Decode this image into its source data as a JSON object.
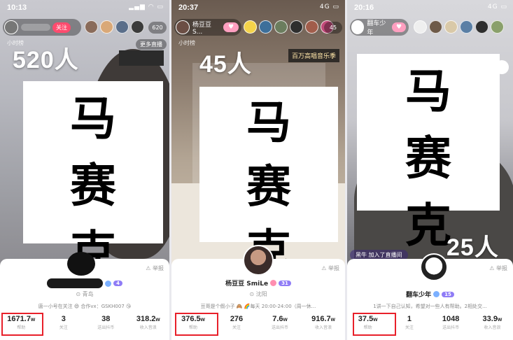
{
  "panels": [
    {
      "status": {
        "time": "10:13",
        "signal": ""
      },
      "anchor": {
        "follow_label": "关注"
      },
      "viewer_count": "620",
      "hour_tag": "小时榜",
      "more_live": "更多直播",
      "overlay_number": "520人",
      "mosaic_chars": [
        "马",
        "赛",
        "克"
      ],
      "shop_sign": "",
      "card": {
        "report": "举报",
        "location": "青岛",
        "level": "4",
        "bio": "唐一小号在关注 😄 合作vx：GSKH007 😘",
        "stats": [
          {
            "value": "1671.7",
            "unit": "w",
            "label": "帮助"
          },
          {
            "value": "3",
            "unit": "",
            "label": "关注"
          },
          {
            "value": "38",
            "unit": "",
            "label": "送出抖币"
          },
          {
            "value": "318.2",
            "unit": "w",
            "label": "收入音浪"
          }
        ]
      }
    },
    {
      "status": {
        "time": "20:37",
        "signal": "4G"
      },
      "anchor": {
        "name": "杨豆豆S..."
      },
      "viewer_count": "45",
      "hour_tag": "小时榜",
      "overlay_number": "45人",
      "song_banner": "百万高唱音乐季",
      "mosaic_chars": [
        "马",
        "赛",
        "克"
      ],
      "card": {
        "report": "举报",
        "name": "杨豆豆 SmiLe",
        "level": "31",
        "location": "沈阳",
        "bio": "豆哥是个假小子 🙈 🌈每天 20:00-24:00（周一休...",
        "stats": [
          {
            "value": "376.5",
            "unit": "w",
            "label": "帮助"
          },
          {
            "value": "276",
            "unit": "",
            "label": "关注"
          },
          {
            "value": "7.6",
            "unit": "w",
            "label": "送出抖币"
          },
          {
            "value": "916.7",
            "unit": "w",
            "label": "收入音浪"
          }
        ]
      }
    },
    {
      "status": {
        "time": "20:16",
        "signal": "4G"
      },
      "anchor": {
        "name": "翻车少年"
      },
      "overlay_number": "25人",
      "join_tip": "黑牛 加入了直播间",
      "mosaic_chars": [
        "马",
        "赛",
        "克"
      ],
      "card": {
        "report": "举报",
        "name": "翻车少年",
        "level": "15",
        "bio": "1讲一下自己认知，希望对一些人有帮助。2相处交...",
        "stats": [
          {
            "value": "37.5",
            "unit": "w",
            "label": "帮助"
          },
          {
            "value": "1",
            "unit": "",
            "label": "关注"
          },
          {
            "value": "1048",
            "unit": "",
            "label": "送出抖币"
          },
          {
            "value": "33.9",
            "unit": "w",
            "label": "收入音浪"
          }
        ]
      }
    }
  ],
  "colors": {
    "highlight_box": "#e8202a",
    "follow": "#ff4b6e",
    "level_badge": "#8f7cf6"
  }
}
